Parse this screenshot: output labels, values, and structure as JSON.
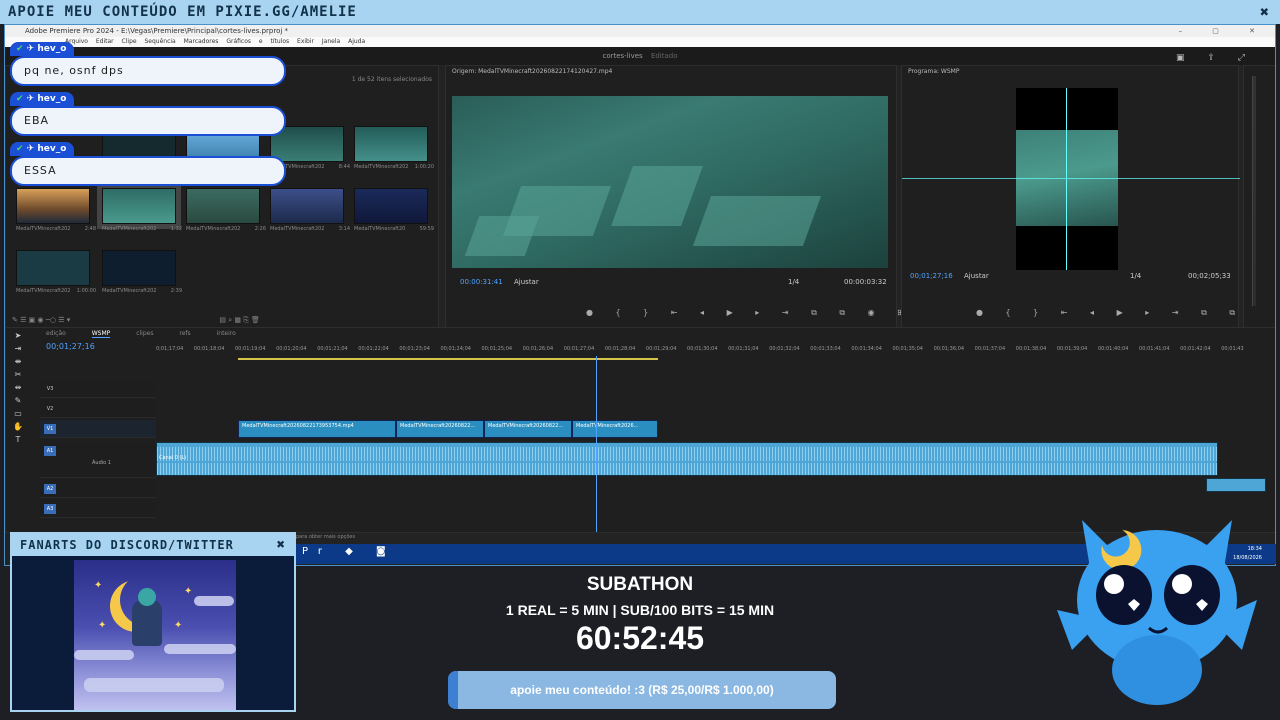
{
  "stream": {
    "banner": "APOIE MEU CONTEÚDO EM PIXIE.GG/AMELIE",
    "close": "✖",
    "fanart_title": "FANARTS DO DISCORD/TWITTER",
    "subathon_title": "SUBATHON",
    "subathon_rates": "1 REAL = 5 MIN | SUB/100 BITS = 15 MIN",
    "timer": "60:52:45",
    "goal_text": "apoie meu conteúdo! :3 (R$ 25,00/R$ 1.000,00)",
    "goal_progress": 0.025
  },
  "chat": [
    {
      "user": "hev_o",
      "message": "pq ne, osnf dps"
    },
    {
      "user": "hev_o",
      "message": "EBA"
    },
    {
      "user": "hev_o",
      "message": "ESSA"
    }
  ],
  "premiere": {
    "title": "Adobe Premiere Pro 2024 - E:\\Vegas\\Premiere\\Principal\\cortes-lives.prproj *",
    "menu": "Arquivo Editar Clipe Sequência Marcadores Gráficos e títulos Exibir Janela Ajuda",
    "project_tab": "cortes-lives",
    "project_status": "Editado",
    "bin_selection": "1 de 52 itens selecionados",
    "clips": [
      {
        "name": "MedalTVMinecraft202",
        "dur": "8:44"
      },
      {
        "name": "MedalTVMinecraft202",
        "dur": "1:00:20"
      },
      {
        "name": "MedalTVMinecraft202",
        "dur": "2:48"
      },
      {
        "name": "MedalTVMinecraft202",
        "dur": "1:32"
      },
      {
        "name": "MedalTVMinecraft202",
        "dur": "2:26"
      },
      {
        "name": "MedalTVMinecraft202",
        "dur": "3:14"
      },
      {
        "name": "MedalTVMinecraft20",
        "dur": "59:59"
      },
      {
        "name": "MedalTVMinecraft202",
        "dur": "1:00:00"
      },
      {
        "name": "MedalTVMinecraft202",
        "dur": "2:39"
      }
    ],
    "source_title": "Origem: MedalTVMinecraft20260822174120427.mp4",
    "source_tc": "00:00:31:41",
    "source_fit": "Ajustar",
    "source_scale": "1/4",
    "source_dur": "00:00:03:32",
    "program_title": "Programa: WSMP",
    "program_tc": "00;01;27;16",
    "program_fit": "Ajustar",
    "program_scale": "1/4",
    "program_dur": "00;02;05;33",
    "timeline_tabs": [
      "edição",
      "WSMP",
      "clipes",
      "refs",
      "inteiro"
    ],
    "timeline_tc": "00;01;27;16",
    "ruler": "0;01;17;04 00;01;18;04 00;01;19;04 00;01;20;04 00;01;21;04 00;01;22;04 00;01;23;04 00;01;24;04 00;01;25;04 00;01;26;04 00;01;27;04 00;01;28;04 00;01;29;04 00;01;30;04 00;01;31;04 00;01;32;04 00;01;33;04 00;01;34;04 00;01;35;04 00;01;36;04 00;01;37;04 00;01;38;04 00;01;39;04 00;01;40;04 00;01;41;04 00;01;42;04 00;01;43",
    "video_clips": [
      "MedalTVMinecraft20260822173953754.mp4",
      "MedalTVMinecraft20260822...",
      "MedalTVMinecraft20260822...",
      "MedalTVMinecraft2026..."
    ],
    "audio_label": "Áudio 1",
    "channel_label": "Canal 0 (L)",
    "status_hint": "para obter mais opções",
    "clock_time": "18:34",
    "clock_date": "18/08/2026"
  }
}
